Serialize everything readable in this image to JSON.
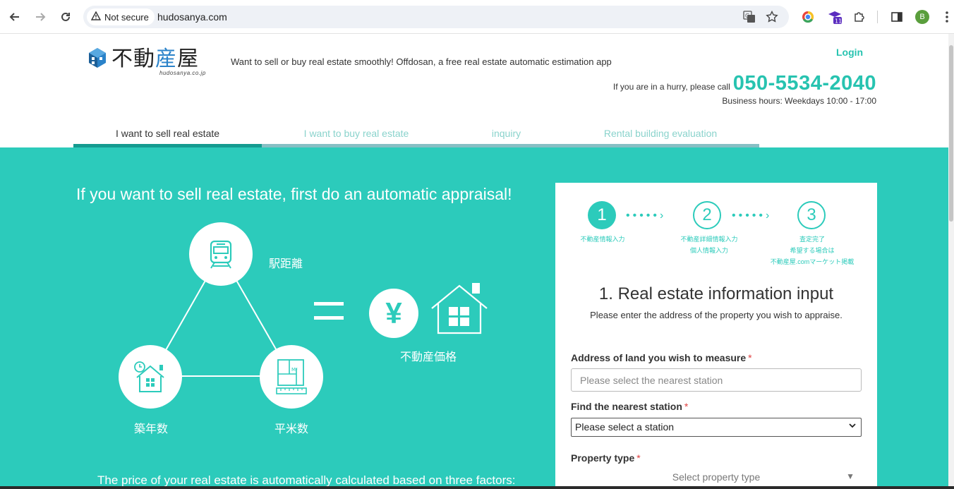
{
  "browser": {
    "security_label": "Not secure",
    "url": "hudosanya.com",
    "extension_badge": "11",
    "profile_initial": "B"
  },
  "header": {
    "logo_text_a": "不動",
    "logo_text_b": "産",
    "logo_text_c": "屋",
    "logo_sub": "hudosanya.co.jp",
    "tagline": "Want to sell or buy real estate smoothly! Offdosan, a free real estate automatic estimation app",
    "login": "Login",
    "hurry_text": "If you are in a hurry, please call",
    "phone": "050-5534-2040",
    "hours": "Business hours: Weekdays 10:00 - 17:00"
  },
  "tabs": [
    {
      "label": "I want to sell real estate",
      "active": true
    },
    {
      "label": "I want to buy real estate",
      "active": false
    },
    {
      "label": "inquiry",
      "active": false
    },
    {
      "label": "Rental building evaluation",
      "active": false
    }
  ],
  "hero": {
    "title": "If you want to sell real estate, first do an automatic appraisal!",
    "factor_station": "駅距離",
    "factor_age": "築年数",
    "factor_area": "平米数",
    "result_label": "不動産価格",
    "yen_symbol": "¥",
    "bottom_text": "The price of your real estate is automatically calculated based on three factors:"
  },
  "form": {
    "steps": [
      {
        "num": "1",
        "label_lines": [
          "不動産情報入力"
        ]
      },
      {
        "num": "2",
        "label_lines": [
          "不動産詳細情報入力",
          "個人情報入力"
        ]
      },
      {
        "num": "3",
        "label_lines": [
          "査定完了",
          "希望する場合は",
          "不動産屋.comマーケット掲載"
        ]
      }
    ],
    "title": "1. Real estate information input",
    "subtitle": "Please enter the address of the property you wish to appraise.",
    "address_label": "Address of land you wish to measure",
    "address_placeholder": "Please select the nearest station",
    "station_label": "Find the nearest station",
    "station_value": "Please select a station",
    "ptype_label": "Property type",
    "ptype_placeholder": "Select property type",
    "required_mark": "*"
  },
  "colors": {
    "teal": "#2ccbbb",
    "active_tab": "#159b90",
    "logo_blue": "#2a82c9",
    "required": "#e04040"
  }
}
